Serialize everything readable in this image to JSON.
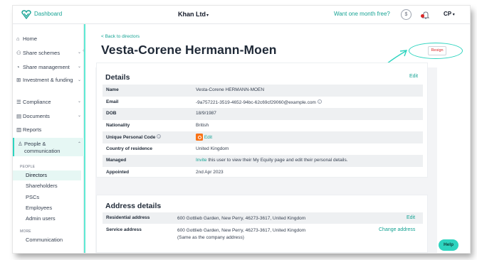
{
  "topbar": {
    "dashboard_label": "Dashboard",
    "company_name": "Khan Ltd",
    "promo_link": "Want one month free?",
    "user_initials": "CP"
  },
  "sidebar": {
    "items": [
      {
        "label": "Home",
        "icon": "home-icon"
      },
      {
        "label": "Share schemes",
        "icon": "users-icon"
      },
      {
        "label": "Share management",
        "icon": "pie-chart-icon"
      },
      {
        "label": "Investment & funding",
        "icon": "bank-icon"
      },
      {
        "label": "Compliance",
        "icon": "list-icon"
      },
      {
        "label": "Documents",
        "icon": "document-icon"
      },
      {
        "label": "Reports",
        "icon": "bar-chart-icon"
      },
      {
        "label": "People & communication",
        "icon": "person-icon"
      }
    ],
    "group_people": "PEOPLE",
    "people_items": [
      "Directors",
      "Shareholders",
      "PSCs",
      "Employees",
      "Admin users"
    ],
    "group_more": "MORE",
    "more_items": [
      "Communication"
    ]
  },
  "main": {
    "back_link": "< Back to directors",
    "title": "Vesta-Corene Hermann-Moen",
    "resign_label": "Resign"
  },
  "details": {
    "title": "Details",
    "edit_label": "Edit",
    "rows": [
      {
        "label": "Name",
        "value": "Vesta-Corene HERMANN-MOEN"
      },
      {
        "label": "Email",
        "value": "-9a757221-3519-4652-94bc-62c69cf29060@example.com"
      },
      {
        "label": "DOB",
        "value": "18/9/1987"
      },
      {
        "label": "Nationality",
        "value": "British"
      },
      {
        "label": "Unique Personal Code",
        "value": "Edit"
      },
      {
        "label": "Country of residence",
        "value": "United Kingdom"
      },
      {
        "label": "Managed",
        "link": "Invite",
        "value": "this user to view their My Equity page and edit their personal details."
      },
      {
        "label": "Appointed",
        "value": "2nd Apr 2023"
      }
    ]
  },
  "address": {
    "title": "Address details",
    "residential_label": "Residential address",
    "residential_value": "600 Gottlieb Garden, New Perry, 46273-3617, United Kingdom",
    "residential_action": "Edit",
    "service_label": "Service address",
    "service_value": "600 Gottlieb Garden, New Perry, 46273-3617, United Kingdom",
    "service_note": "(Same as the company address)",
    "service_action": "Change address"
  },
  "help_label": "Help",
  "colors": {
    "accent": "#16a394",
    "highlight": "#2dd4bf",
    "danger": "#dc2626",
    "upc_icon": "#f97316"
  }
}
